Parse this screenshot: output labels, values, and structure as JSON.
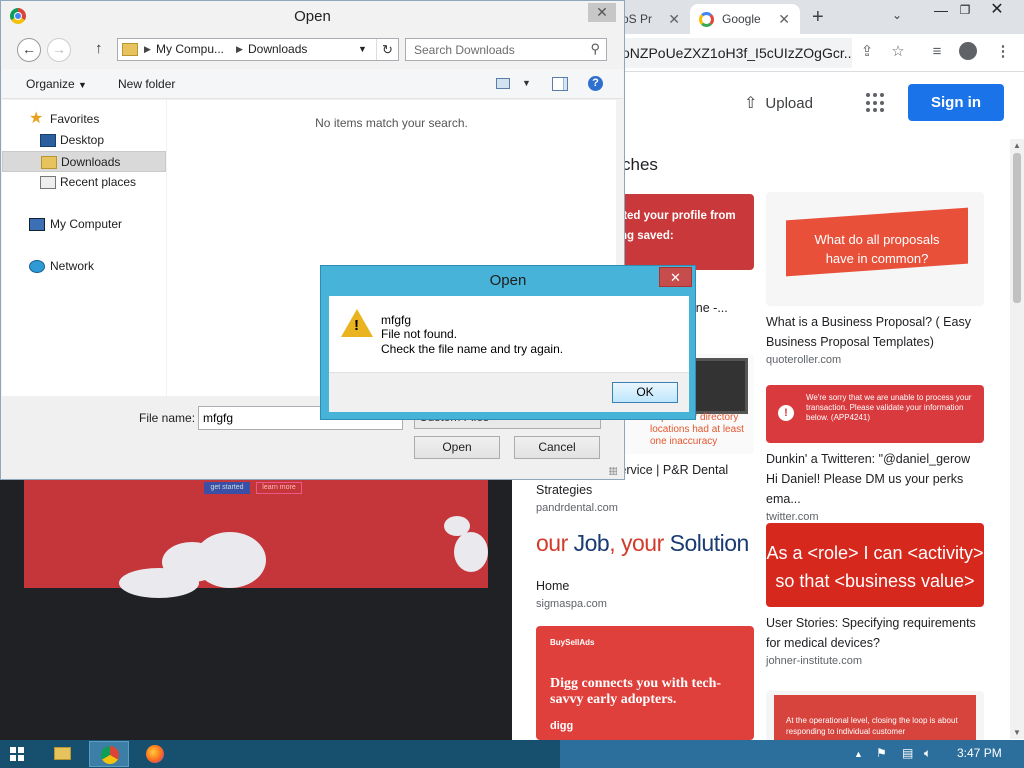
{
  "browser": {
    "tabs": [
      {
        "label": "oS Pr"
      },
      {
        "label": "Google"
      }
    ],
    "omnibox_text": "oNZPoUeZXZ1oH3f_I5cUIzZOgGcr...",
    "upload_label": "Upload",
    "signin_label": "Sign in",
    "page_heading": "ches",
    "colors": {
      "signin": "#1a73e8",
      "card_red": "#d94a3e"
    },
    "cards": [
      {
        "thumb_text": "ited your profile from\nng saved:",
        "title": "Beeline -...",
        "source": ""
      },
      {
        "thumb_text": "What do all proposals\nhave in common?",
        "title": "What is a Business Proposal? ( Easy Business Proposal Templates)",
        "source": "quoteroller.com"
      },
      {
        "thumb_text": "of provider directory\nlocations had at least\none inaccuracy",
        "title": "ory Accuracy Service | P&R Dental Strategies",
        "source": "pandrdental.com"
      },
      {
        "thumb_text": "We're sorry that we are unable to process your transaction. Please validate your information below. (APP4241)",
        "title": "Dunkin' a Twitteren: \"@daniel_gerow Hi Daniel! Please DM us your perks ema...",
        "source": "twitter.com"
      },
      {
        "thumb_text_1": "our ",
        "thumb_text_2": "Job",
        "thumb_text_3": ", your ",
        "thumb_text_4": "Solution",
        "title": "Home",
        "source": "sigmaspa.com"
      },
      {
        "thumb_text": "As a <role> I can <activity>\nso that <business value>",
        "title": "User Stories: Specifying requirements for medical devices?",
        "source": "johner-institute.com"
      },
      {
        "thumb_brand": "BuySellAds",
        "thumb_text": "Digg connects you with tech-savvy early adopters.",
        "thumb_logo": "digg",
        "title": "",
        "source": ""
      },
      {
        "thumb_text": "At the operational level, closing the loop is about responding to individual customer",
        "title": "",
        "source": ""
      }
    ],
    "bg_page": {
      "btn1": "get started",
      "btn2": "learn more"
    }
  },
  "open_dialog": {
    "title": "Open",
    "address": {
      "seg1": "My Compu...",
      "seg2": "Downloads"
    },
    "search_placeholder": "Search Downloads",
    "organize_label": "Organize",
    "new_folder_label": "New folder",
    "nav": {
      "favorites": "Favorites",
      "desktop": "Desktop",
      "downloads": "Downloads",
      "recent": "Recent places",
      "computer": "My Computer",
      "network": "Network"
    },
    "empty_message": "No items match your search.",
    "file_name_label": "File name:",
    "file_name_value": "mfgfg",
    "file_type": "Custom Files",
    "open_label": "Open",
    "cancel_label": "Cancel"
  },
  "message_box": {
    "title": "Open",
    "line1": "mfgfg",
    "line2": "File not found.",
    "line3": "Check the file name and try again.",
    "ok_label": "OK"
  },
  "taskbar": {
    "clock": "3:47 PM"
  }
}
